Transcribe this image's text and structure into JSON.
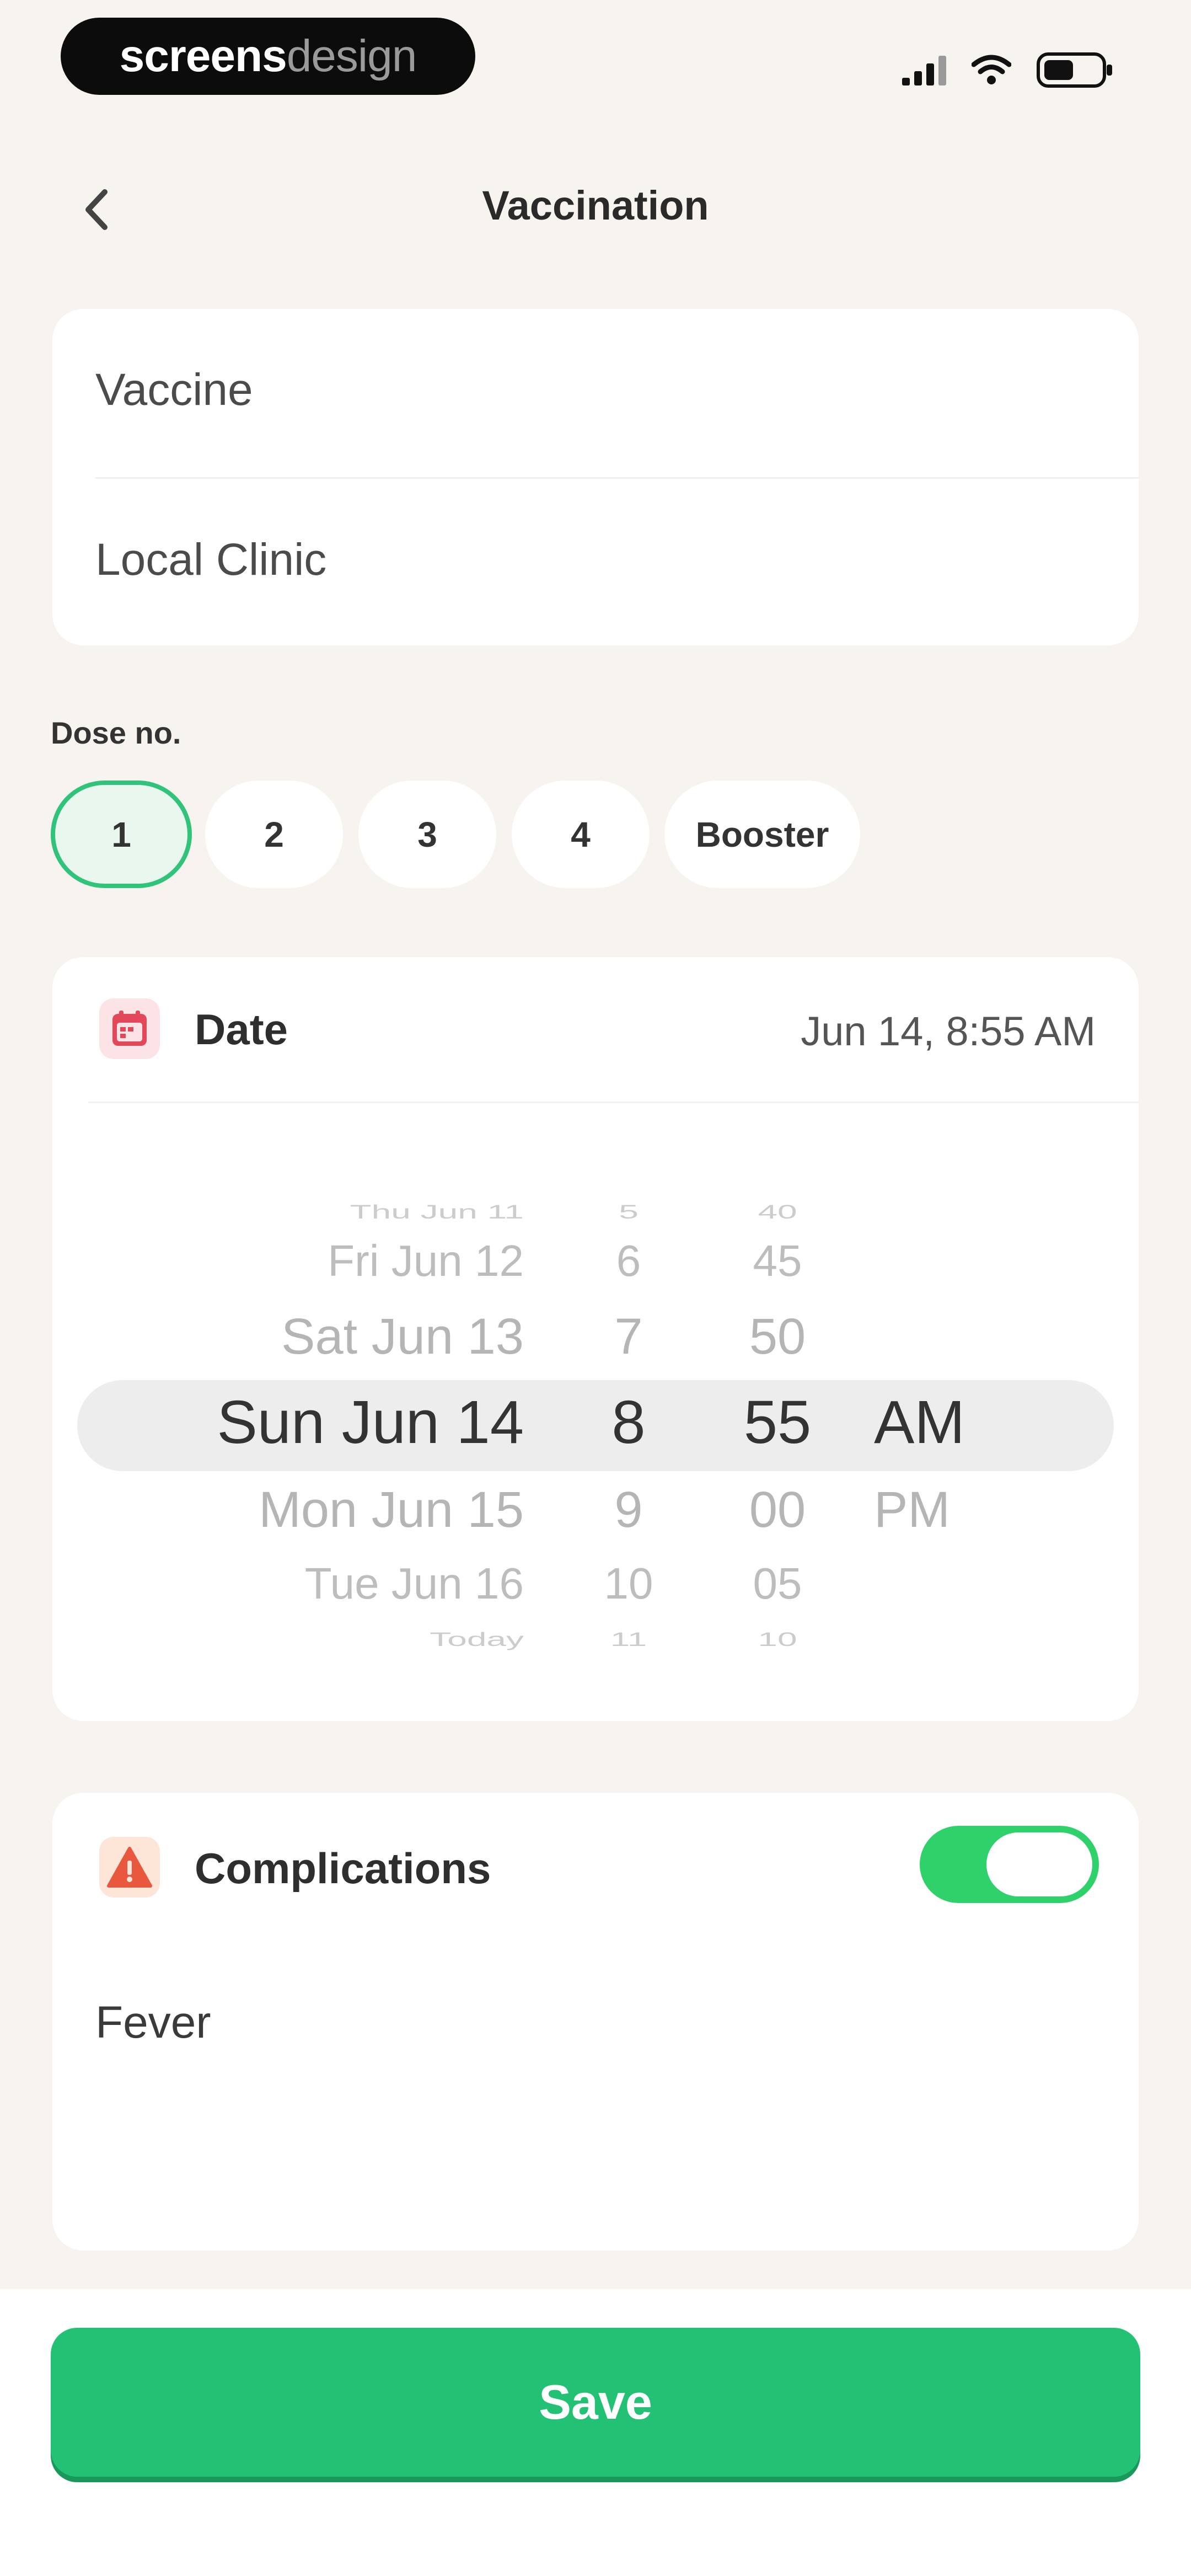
{
  "status_bar": {
    "brand_part1": "screens",
    "brand_part2": "design"
  },
  "header": {
    "title": "Vaccination",
    "back_icon": "chevron-left-icon"
  },
  "fields": {
    "vaccine": "Vaccine",
    "clinic": "Local Clinic"
  },
  "dose": {
    "label": "Dose no.",
    "options": [
      "1",
      "2",
      "3",
      "4",
      "Booster"
    ],
    "selected": "1"
  },
  "date": {
    "label": "Date",
    "value": "Jun 14, 8:55 AM",
    "icon": "calendar-icon",
    "picker": {
      "days": [
        "Thu Jun 11",
        "Fri Jun 12",
        "Sat Jun 13",
        "Sun Jun 14",
        "Mon Jun 15",
        "Tue Jun 16",
        "Today"
      ],
      "hours": [
        "5",
        "6",
        "7",
        "8",
        "9",
        "10",
        "11"
      ],
      "minutes": [
        "40",
        "45",
        "50",
        "55",
        "00",
        "05",
        "10"
      ],
      "periods": [
        "AM",
        "PM"
      ]
    }
  },
  "complications": {
    "label": "Complications",
    "icon": "warning-icon",
    "enabled": true,
    "text": "Fever"
  },
  "footer": {
    "save_label": "Save"
  },
  "colors": {
    "accent": "#22c173",
    "background": "#f7f4ef",
    "toggle_on": "#2fd16b",
    "calendar": "#e2475a",
    "warning": "#e9573f"
  }
}
